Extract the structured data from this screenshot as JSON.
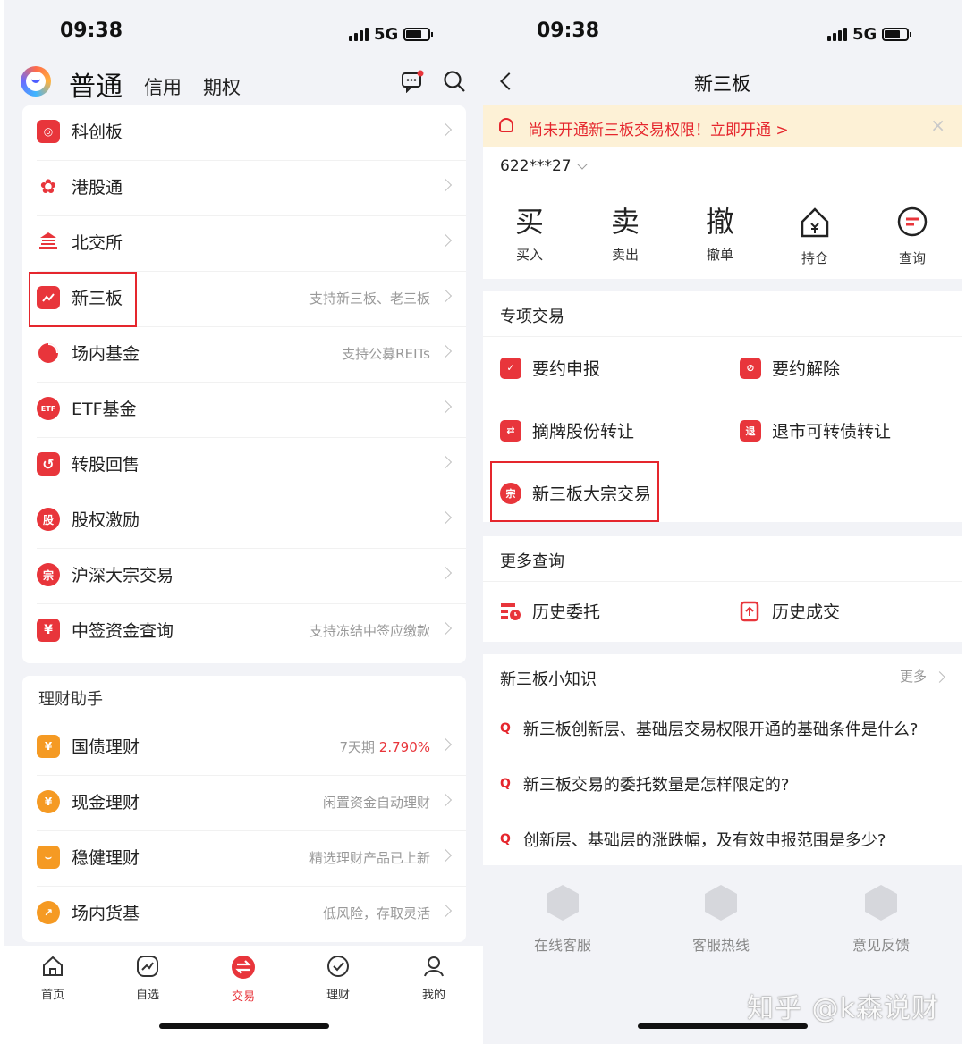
{
  "left": {
    "status": {
      "time": "09:38",
      "network": "5G"
    },
    "header": {
      "main_tab": "普通",
      "tabs": [
        "信用",
        "期权"
      ]
    },
    "menu": [
      {
        "label": "科创板",
        "sub": "",
        "color": "#e8353b"
      },
      {
        "label": "港股通",
        "sub": "",
        "color": "#e8353b"
      },
      {
        "label": "北交所",
        "sub": "",
        "color": "#e8353b"
      },
      {
        "label": "新三板",
        "sub": "支持新三板、老三板",
        "color": "#e8353b"
      },
      {
        "label": "场内基金",
        "sub": "支持公募REITs",
        "color": "#e8353b"
      },
      {
        "label": "ETF基金",
        "sub": "",
        "color": "#e8353b"
      },
      {
        "label": "转股回售",
        "sub": "",
        "color": "#e8353b"
      },
      {
        "label": "股权激励",
        "sub": "",
        "color": "#e8353b"
      },
      {
        "label": "沪深大宗交易",
        "sub": "",
        "color": "#e8353b"
      },
      {
        "label": "中签资金查询",
        "sub": "支持冻结中签应缴款",
        "color": "#e8353b"
      }
    ],
    "icon_glyphs": {
      "etf": "ETF",
      "gu": "股",
      "zong": "宗"
    },
    "finance": {
      "title": "理财助手",
      "items": [
        {
          "label": "国债理财",
          "sub": "7天期 ",
          "sub_highlight": "2.790%",
          "color": "#f59a23"
        },
        {
          "label": "现金理财",
          "sub": "闲置资金自动理财",
          "sub_highlight": "",
          "color": "#f59a23"
        },
        {
          "label": "稳健理财",
          "sub": "精选理财产品已上新",
          "sub_highlight": "",
          "color": "#f59a23"
        },
        {
          "label": "场内货基",
          "sub": "低风险，存取灵活",
          "sub_highlight": "",
          "color": "#f59a23"
        }
      ]
    },
    "nav": [
      {
        "label": "首页",
        "active": false
      },
      {
        "label": "自选",
        "active": false
      },
      {
        "label": "交易",
        "active": true
      },
      {
        "label": "理财",
        "active": false
      },
      {
        "label": "我的",
        "active": false
      }
    ]
  },
  "right": {
    "status": {
      "time": "09:38",
      "network": "5G"
    },
    "title": "新三板",
    "banner": {
      "text": "尚未开通新三板交易权限！立即开通 >",
      "close": "×"
    },
    "account": "622***27",
    "ops": [
      {
        "glyph": "买",
        "label": "买入"
      },
      {
        "glyph": "卖",
        "label": "卖出"
      },
      {
        "glyph": "撤",
        "label": "撤单"
      },
      {
        "glyph": "",
        "label": "持仓"
      },
      {
        "glyph": "",
        "label": "查询"
      }
    ],
    "special": {
      "title": "专项交易",
      "items": [
        {
          "label": "要约申报",
          "glyph": "✓"
        },
        {
          "label": "要约解除",
          "glyph": "⊘"
        },
        {
          "label": "摘牌股份转让",
          "glyph": "⇄"
        },
        {
          "label": "退市可转债转让",
          "glyph": "退"
        },
        {
          "label": "新三板大宗交易",
          "glyph": "宗"
        }
      ]
    },
    "queries": {
      "title": "更多查询",
      "items": [
        {
          "label": "历史委托"
        },
        {
          "label": "历史成交"
        }
      ]
    },
    "knowledge": {
      "title": "新三板小知识",
      "more": "更多",
      "q_mark": "Q",
      "items": [
        "新三板创新层、基础层交易权限开通的基础条件是什么?",
        "新三板交易的委托数量是怎样限定的?",
        "创新层、基础层的涨跌幅，及有效申报范围是多少?"
      ]
    },
    "services": [
      "在线客服",
      "客服热线",
      "意见反馈"
    ],
    "watermark": "知乎 @k森说财"
  }
}
